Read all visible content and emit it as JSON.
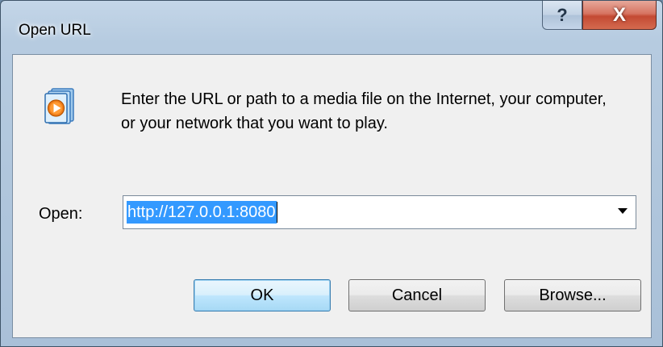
{
  "window": {
    "title": "Open URL",
    "help_glyph": "?",
    "close_glyph": "X"
  },
  "dialog": {
    "icon": "windows-media-player-icon",
    "message": "Enter the URL or path to a media file on the Internet, your computer, or your network that you want to play.",
    "open_label": "Open:",
    "url_value": "http://127.0.0.1:8080"
  },
  "buttons": {
    "ok": "OK",
    "cancel": "Cancel",
    "browse": "Browse..."
  },
  "colors": {
    "selection": "#3399ff",
    "ok_accent": "#3c7fb1",
    "close_red": "#c44a33"
  }
}
